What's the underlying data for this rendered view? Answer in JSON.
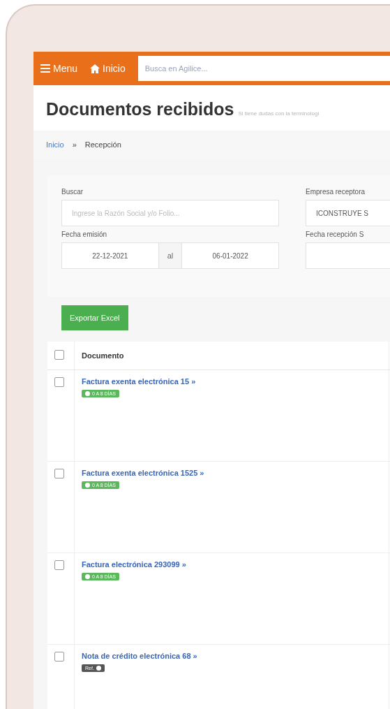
{
  "navbar": {
    "menu_label": "Menu",
    "home_label": "Inicio",
    "search": {
      "placeholder": "Busca en Agilice..."
    }
  },
  "page": {
    "title": "Documentos recibidos",
    "subtitle": "Si tiene dudas con la terminologí"
  },
  "breadcrumb": {
    "separator": "»",
    "items": [
      {
        "label": "Inicio",
        "kind": "link"
      },
      {
        "label": "Recepción",
        "kind": "current"
      }
    ]
  },
  "filters": {
    "search": {
      "label": "Buscar",
      "placeholder": "Ingrese la Razón Social y/o Folio..."
    },
    "company": {
      "label": "Empresa receptora",
      "value": "ICONSTRUYE S"
    },
    "issue_date": {
      "label": "Fecha emisión",
      "from": "22-12-2021",
      "separator": "al",
      "to": "06-01-2022"
    },
    "reception_date": {
      "label": "Fecha recepción S"
    }
  },
  "export_button": "Exportar Excel",
  "table": {
    "select_all_checked": false,
    "columns": [
      "Documento"
    ],
    "rows": [
      {
        "document": "Factura exenta electrónica 15 »",
        "checked": false,
        "badge": {
          "kind": "days",
          "text": "0 A 8 DÍAS"
        }
      },
      {
        "document": "Factura exenta electrónica 1525 »",
        "checked": false,
        "badge": {
          "kind": "days",
          "text": "0 A 8 DÍAS"
        }
      },
      {
        "document": "Factura electrónica 293099 »",
        "checked": false,
        "badge": {
          "kind": "days",
          "text": "0 A 8 DÍAS"
        }
      },
      {
        "document": "Nota de crédito electrónica 68 »",
        "checked": false,
        "badge": {
          "kind": "ref",
          "text": "Ref."
        }
      }
    ]
  }
}
